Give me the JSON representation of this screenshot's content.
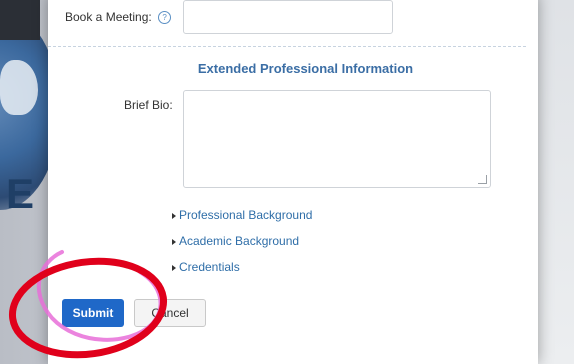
{
  "form": {
    "book_meeting_label": "Book a Meeting:",
    "book_meeting_value": "",
    "section_title": "Extended Professional Information",
    "brief_bio_label": "Brief Bio:",
    "brief_bio_value": "",
    "expanders": [
      {
        "label": "Professional Background"
      },
      {
        "label": "Academic Background"
      },
      {
        "label": "Credentials"
      }
    ],
    "submit_label": "Submit",
    "cancel_label": "Cancel"
  },
  "icons": {
    "help": "question-circle-icon",
    "expander": "triangle-right-icon",
    "resize": "resize-grip-icon"
  },
  "colors": {
    "accent": "#1f68c8",
    "link": "#2f6ea8",
    "section_title": "#3b6ea5",
    "annotation_red": "#e0001b",
    "annotation_pink": "#e86fd8"
  }
}
